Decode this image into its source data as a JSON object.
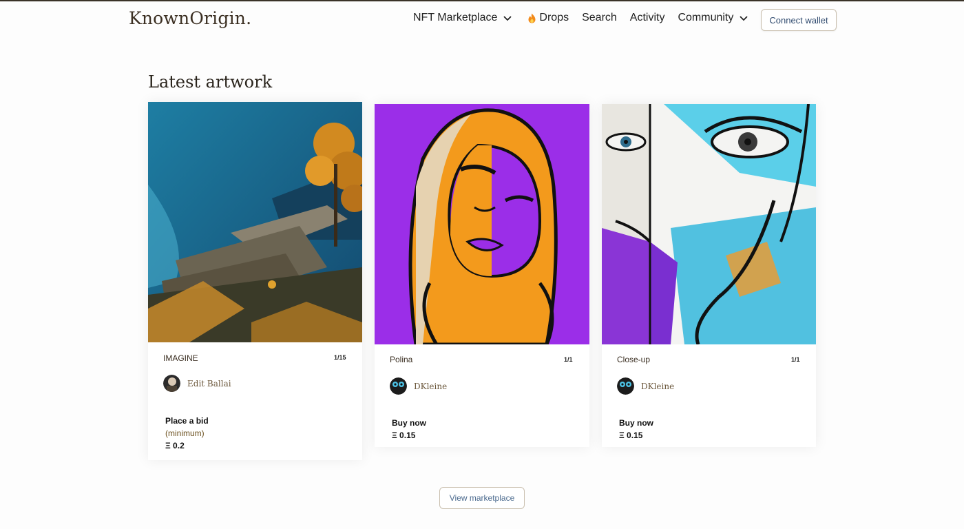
{
  "header": {
    "logo": "KnownOrigin",
    "logo_dot": ".",
    "nav": {
      "marketplace": "NFT Marketplace",
      "drops": "Drops",
      "search": "Search",
      "activity": "Activity",
      "community": "Community"
    },
    "connect_wallet": "Connect wallet"
  },
  "section": {
    "title": "Latest artwork"
  },
  "cards": [
    {
      "title": "IMAGINE",
      "edition": "1/15",
      "artist": "Edit Ballai",
      "price_label": "Place a bid",
      "price_sub": "(minimum)",
      "price": "Ξ 0.2"
    },
    {
      "title": "Polina",
      "edition": "1/1",
      "artist": "DKleine",
      "price_label": "Buy now",
      "price": "Ξ 0.15"
    },
    {
      "title": "Close-up",
      "edition": "1/1",
      "artist": "DKleine",
      "price_label": "Buy now",
      "price": "Ξ 0.15"
    }
  ],
  "footer": {
    "view_marketplace": "View marketplace"
  },
  "colors": {
    "accent": "#2f4a6e",
    "brand": "#3b2f22",
    "purple": "#9b2ee8",
    "orange": "#f39a1c"
  },
  "icons": {
    "nav_chevron": "chevron-down-icon",
    "drops": "flame-icon"
  }
}
